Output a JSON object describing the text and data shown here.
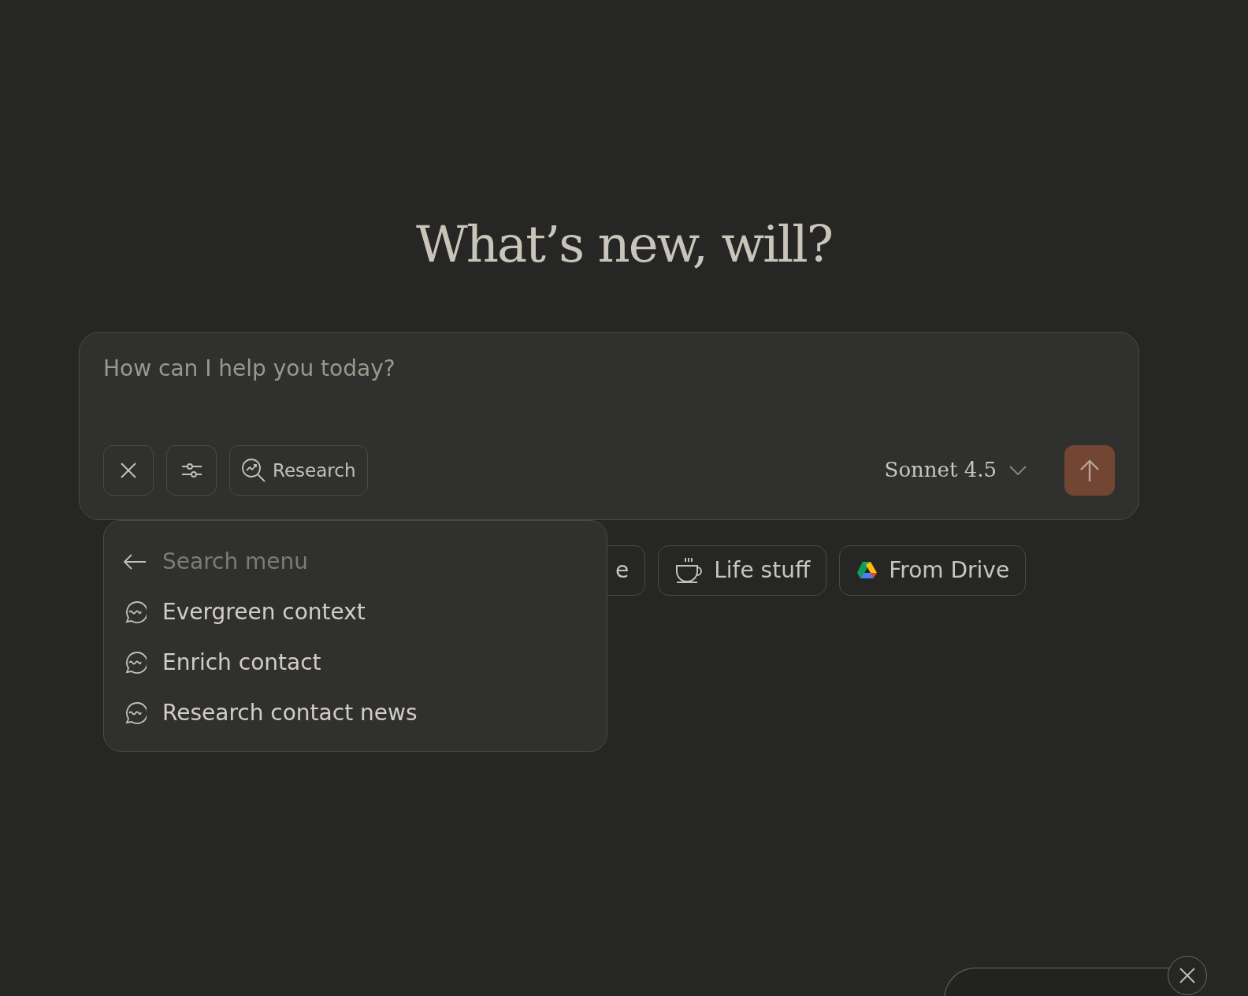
{
  "heading": "What’s new, will?",
  "composer": {
    "placeholder": "How can I help you today?",
    "research_button": "Research",
    "model": "Sonnet 4.5"
  },
  "menu": {
    "search_placeholder": "Search menu",
    "items": [
      {
        "label": "Evergreen context"
      },
      {
        "label": "Enrich contact"
      },
      {
        "label": "Research contact news"
      }
    ]
  },
  "chips": [
    {
      "label": "e",
      "kind": "plain"
    },
    {
      "label": "Life stuff",
      "kind": "cup"
    },
    {
      "label": "From Drive",
      "kind": "drive"
    }
  ]
}
